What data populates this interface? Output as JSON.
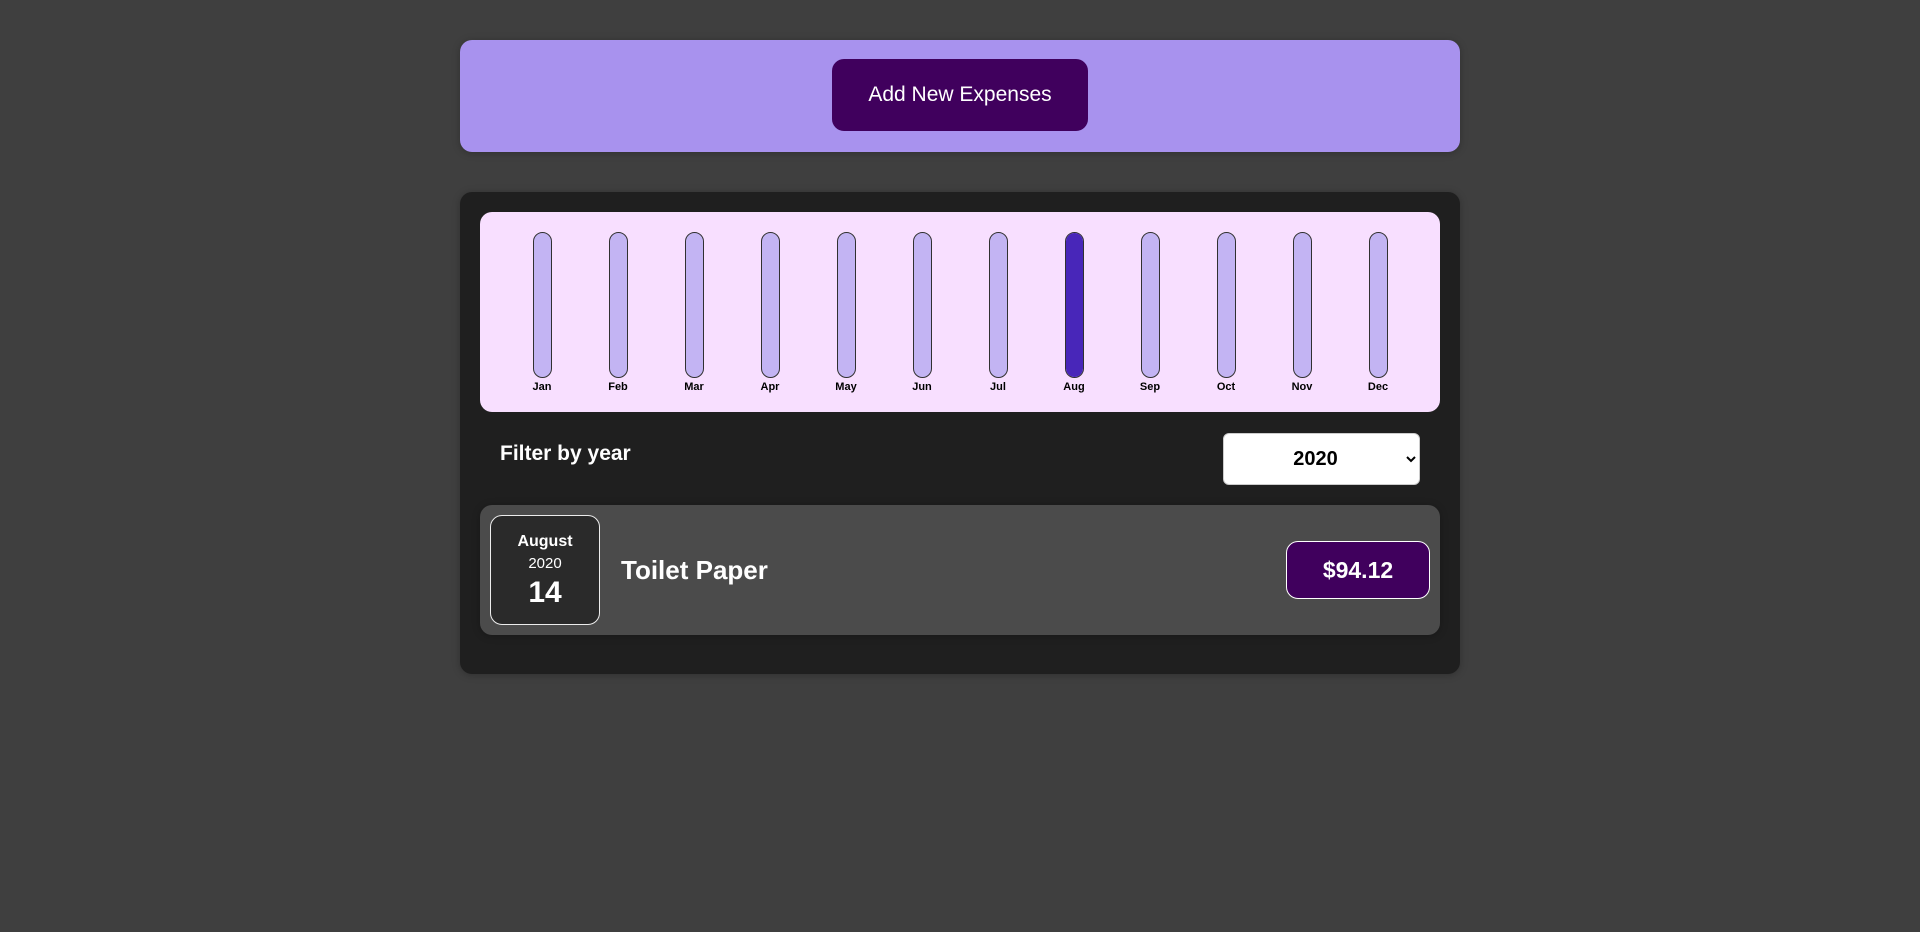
{
  "new_expense": {
    "button_label": "Add New Expenses"
  },
  "chart_data": {
    "type": "bar",
    "categories": [
      "Jan",
      "Feb",
      "Mar",
      "Apr",
      "May",
      "Jun",
      "Jul",
      "Aug",
      "Sep",
      "Oct",
      "Nov",
      "Dec"
    ],
    "values": [
      0,
      0,
      0,
      0,
      0,
      0,
      0,
      94.12,
      0,
      0,
      0,
      0
    ],
    "ylim": [
      0,
      94.12
    ],
    "title": "",
    "xlabel": "",
    "ylabel": "",
    "grid": false,
    "colors": {
      "fill": "#4826b9",
      "track": "#c3b4f3",
      "background": "#f8dfff"
    }
  },
  "filter": {
    "label": "Filter by year",
    "selected_year": "2020",
    "options": [
      "2020"
    ]
  },
  "expenses": [
    {
      "month": "August",
      "year": "2020",
      "day": "14",
      "title": "Toilet Paper",
      "amount": "$94.12"
    }
  ],
  "colors": {
    "page_background": "#3f3f3f",
    "header_background": "#a892ee",
    "accent": "#40005d",
    "panel_background": "#1f1f1f",
    "item_background": "#4b4b4b"
  }
}
